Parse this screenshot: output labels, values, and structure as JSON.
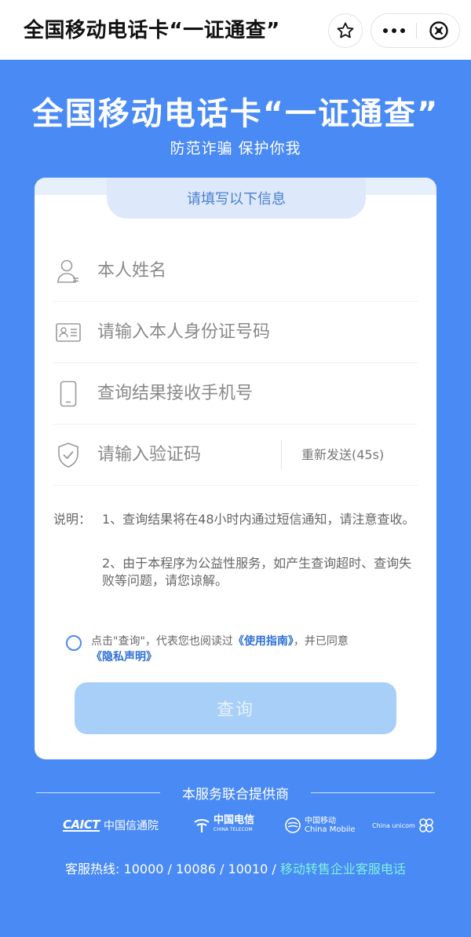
{
  "nav": {
    "title": "全国移动电话卡“一证通查”"
  },
  "hero": {
    "title": "全国移动电话卡“一证通查”",
    "subtitle": "防范诈骗 保护你我"
  },
  "form": {
    "tab_label": "请填写以下信息",
    "name_placeholder": "本人姓名",
    "id_placeholder": "请输入本人身份证号码",
    "phone_placeholder": "查询结果接收手机号",
    "code_placeholder": "请输入验证码",
    "resend_label": "重新发送(45s)"
  },
  "notes": {
    "label": "说明：",
    "items": [
      "1、查询结果将在48小时内通过短信通知，请注意查收。",
      "2、由于本程序为公益性服务，如产生查询超时、查询失败等问题，请您谅解。"
    ]
  },
  "agreement": {
    "prefix": "点击\"查询\"，代表您也阅读过",
    "guide_link": "《使用指南》",
    "middle": "，并已同意",
    "privacy_link": "《隐私声明》"
  },
  "query_button": "查询",
  "footer": {
    "provider_title": "本服务联合提供商",
    "logos": {
      "caict_mark": "CAICT",
      "caict_name": "中国信通院",
      "telecom_name": "中国电信",
      "telecom_en": "CHINA TELECOM",
      "mobile_name": "中国移动",
      "mobile_en": "China Mobile",
      "unicom_en": "China unicom"
    },
    "hotline_prefix": "客服热线: 10000 / 10086 / 10010 / ",
    "hotline_link": "移动转售企业客服电话"
  },
  "colors": {
    "background": "#4a8af4",
    "accent": "#2f6fd6",
    "button_disabled": "#a7cff7",
    "link_cyan": "#7ff0e0"
  },
  "icons": [
    "star-icon",
    "more-icon",
    "close-icon",
    "user-icon",
    "id-card-icon",
    "phone-icon",
    "shield-icon"
  ]
}
